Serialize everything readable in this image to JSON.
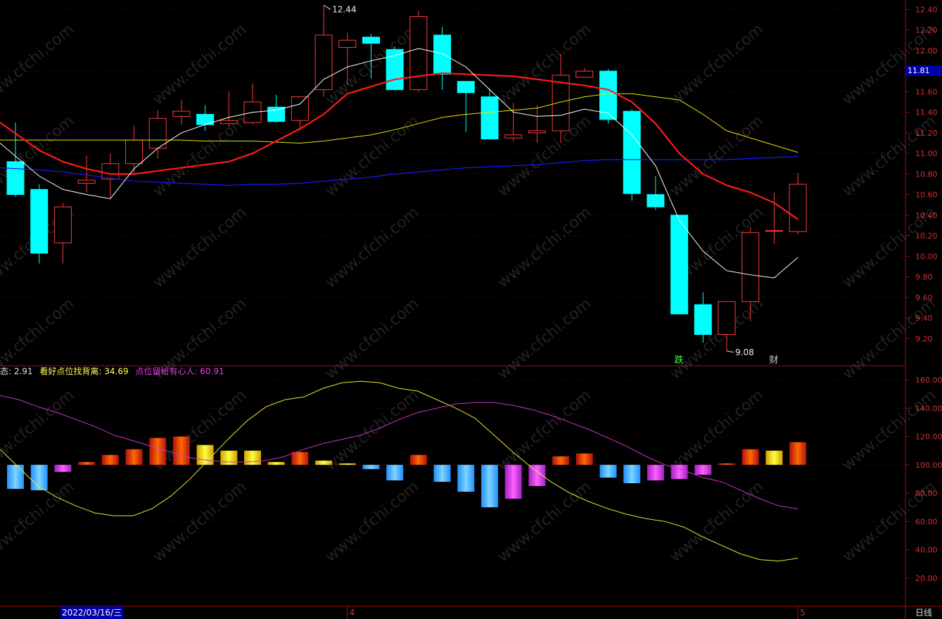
{
  "current_price_label": "11.81",
  "period_label": "日线",
  "cursor_date": "2022/03/16/三",
  "month_labels": [
    "4",
    "5"
  ],
  "indicator_header": [
    {
      "text": "态: 2.91",
      "color": "#dddddd"
    },
    {
      "text": "看好点位找背离: 34.69",
      "color": "#ffff55"
    },
    {
      "text": "点位留给有心人: 60.91",
      "color": "#e040e0"
    }
  ],
  "watermark_text": "www.cfchi.com",
  "chart_data": [
    {
      "type": "candlestick",
      "yaxis_ticks": [
        "12.40",
        "12.20",
        "12.00",
        "11.80",
        "11.60",
        "11.40",
        "11.20",
        "11.00",
        "10.80",
        "10.60",
        "10.40",
        "10.20",
        "10.00",
        "9.80",
        "9.60",
        "9.40",
        "9.20"
      ],
      "ylim": [
        9.1,
        12.45
      ],
      "colors": {
        "up": "#ff3b3b",
        "down": "#00ffff",
        "ma_fast": "#ffffff",
        "ma_mid": "#ff1a1a",
        "ma_slow": "#e6e600",
        "ma_long": "#1a1aff"
      },
      "candles": [
        {
          "o": 10.92,
          "h": 11.3,
          "l": 10.58,
          "c": 10.6
        },
        {
          "o": 10.65,
          "h": 10.7,
          "l": 9.93,
          "c": 10.03
        },
        {
          "o": 10.13,
          "h": 10.52,
          "l": 9.93,
          "c": 10.48
        },
        {
          "o": 10.71,
          "h": 10.98,
          "l": 10.62,
          "c": 10.74
        },
        {
          "o": 10.75,
          "h": 11.0,
          "l": 10.57,
          "c": 10.9
        },
        {
          "o": 10.9,
          "h": 11.27,
          "l": 10.81,
          "c": 11.13
        },
        {
          "o": 11.05,
          "h": 11.42,
          "l": 10.95,
          "c": 11.34
        },
        {
          "o": 11.36,
          "h": 11.52,
          "l": 11.28,
          "c": 11.41
        },
        {
          "o": 11.38,
          "h": 11.47,
          "l": 11.22,
          "c": 11.28
        },
        {
          "o": 11.29,
          "h": 11.6,
          "l": 11.26,
          "c": 11.32
        },
        {
          "o": 11.3,
          "h": 11.68,
          "l": 11.28,
          "c": 11.5
        },
        {
          "o": 11.45,
          "h": 11.57,
          "l": 11.3,
          "c": 11.31
        },
        {
          "o": 11.32,
          "h": 11.55,
          "l": 11.22,
          "c": 11.55
        },
        {
          "o": 11.62,
          "h": 12.44,
          "l": 11.55,
          "c": 12.15
        },
        {
          "o": 12.03,
          "h": 12.17,
          "l": 11.66,
          "c": 12.1
        },
        {
          "o": 12.13,
          "h": 12.16,
          "l": 11.73,
          "c": 12.07
        },
        {
          "o": 12.01,
          "h": 12.04,
          "l": 11.61,
          "c": 11.62
        },
        {
          "o": 11.62,
          "h": 12.39,
          "l": 11.6,
          "c": 12.33
        },
        {
          "o": 12.15,
          "h": 12.23,
          "l": 11.62,
          "c": 11.77
        },
        {
          "o": 11.7,
          "h": 11.7,
          "l": 11.21,
          "c": 11.59
        },
        {
          "o": 11.55,
          "h": 11.63,
          "l": 11.15,
          "c": 11.14
        },
        {
          "o": 11.15,
          "h": 11.49,
          "l": 11.12,
          "c": 11.18
        },
        {
          "o": 11.2,
          "h": 11.47,
          "l": 11.1,
          "c": 11.22
        },
        {
          "o": 11.22,
          "h": 11.97,
          "l": 11.1,
          "c": 11.76
        },
        {
          "o": 11.74,
          "h": 11.83,
          "l": 11.74,
          "c": 11.8
        },
        {
          "o": 11.8,
          "h": 11.82,
          "l": 11.29,
          "c": 11.33
        },
        {
          "o": 11.41,
          "h": 11.43,
          "l": 10.54,
          "c": 10.61
        },
        {
          "o": 10.6,
          "h": 10.78,
          "l": 10.45,
          "c": 10.48
        },
        {
          "o": 10.4,
          "h": 10.4,
          "l": 9.44,
          "c": 9.44
        },
        {
          "o": 9.53,
          "h": 9.65,
          "l": 9.16,
          "c": 9.24
        },
        {
          "o": 9.24,
          "h": 9.56,
          "l": 9.08,
          "c": 9.56
        },
        {
          "o": 9.56,
          "h": 10.28,
          "l": 9.37,
          "c": 10.23
        },
        {
          "o": 10.25,
          "h": 10.62,
          "l": 10.12,
          "c": 10.25
        },
        {
          "o": 10.24,
          "h": 10.81,
          "l": 10.21,
          "c": 10.7
        }
      ],
      "ma_fast": [
        11.1,
        10.78,
        10.65,
        10.6,
        10.56,
        10.85,
        11.05,
        11.2,
        11.28,
        11.35,
        11.4,
        11.42,
        11.48,
        11.72,
        11.84,
        11.9,
        11.95,
        12.02,
        11.97,
        11.84,
        11.62,
        11.4,
        11.36,
        11.37,
        11.43,
        11.39,
        11.18,
        10.88,
        10.35,
        10.05,
        9.86,
        9.82,
        9.79,
        9.99
      ],
      "ma_mid": [
        11.3,
        11.03,
        10.92,
        10.85,
        10.8,
        10.8,
        10.83,
        10.86,
        10.89,
        10.92,
        11.0,
        11.12,
        11.24,
        11.38,
        11.58,
        11.65,
        11.72,
        11.75,
        11.78,
        11.77,
        11.76,
        11.75,
        11.72,
        11.69,
        11.66,
        11.62,
        11.5,
        11.29,
        11.0,
        10.8,
        10.69,
        10.62,
        10.52,
        10.36
      ],
      "ma_slow": [
        11.13,
        11.13,
        11.13,
        11.13,
        11.13,
        11.13,
        11.13,
        11.13,
        11.12,
        11.12,
        11.12,
        11.11,
        11.1,
        11.12,
        11.15,
        11.18,
        11.23,
        11.29,
        11.35,
        11.38,
        11.4,
        11.42,
        11.44,
        11.5,
        11.55,
        11.58,
        11.58,
        11.55,
        11.52,
        11.38,
        11.22,
        11.15,
        11.08,
        11.01
      ],
      "ma_long": [
        10.86,
        10.84,
        10.82,
        10.79,
        10.76,
        10.73,
        10.72,
        10.71,
        10.7,
        10.69,
        10.7,
        10.7,
        10.71,
        10.73,
        10.75,
        10.77,
        10.8,
        10.82,
        10.84,
        10.86,
        10.87,
        10.88,
        10.89,
        10.91,
        10.93,
        10.94,
        10.94,
        10.94,
        10.94,
        10.94,
        10.94,
        10.95,
        10.96,
        10.97
      ],
      "annotations": [
        {
          "text": "12.44",
          "candle": 13,
          "at": "high"
        },
        {
          "text": "9.08",
          "candle": 30,
          "at": "low"
        }
      ],
      "markers": [
        {
          "text": "跌",
          "candle": 28,
          "color": "#44ff44"
        },
        {
          "text": "财",
          "candle": 32,
          "color": "#cccccc"
        }
      ]
    },
    {
      "type": "bar",
      "yaxis_ticks": [
        "160.00",
        "140.00",
        "120.00",
        "100.00",
        "80.00",
        "60.00",
        "40.00",
        "20.00"
      ],
      "ylim": [
        5,
        165
      ],
      "baseline": 100,
      "bars": [
        {
          "v": 83,
          "color": "blue"
        },
        {
          "v": 82,
          "color": "blue"
        },
        {
          "v": 95,
          "color": "magenta"
        },
        {
          "v": 102,
          "color": "red"
        },
        {
          "v": 107,
          "color": "red"
        },
        {
          "v": 111,
          "color": "red"
        },
        {
          "v": 119,
          "color": "red"
        },
        {
          "v": 120,
          "color": "red"
        },
        {
          "v": 114,
          "color": "yellow"
        },
        {
          "v": 110,
          "color": "yellow"
        },
        {
          "v": 110,
          "color": "yellow"
        },
        {
          "v": 102,
          "color": "yellow"
        },
        {
          "v": 109,
          "color": "red"
        },
        {
          "v": 103,
          "color": "yellow"
        },
        {
          "v": 101,
          "color": "yellow"
        },
        {
          "v": 97,
          "color": "blue"
        },
        {
          "v": 89,
          "color": "blue"
        },
        {
          "v": 107,
          "color": "red"
        },
        {
          "v": 88,
          "color": "blue"
        },
        {
          "v": 81,
          "color": "blue"
        },
        {
          "v": 70,
          "color": "blue"
        },
        {
          "v": 76,
          "color": "magenta"
        },
        {
          "v": 85,
          "color": "magenta"
        },
        {
          "v": 106,
          "color": "red"
        },
        {
          "v": 108,
          "color": "red"
        },
        {
          "v": 91,
          "color": "blue"
        },
        {
          "v": 87,
          "color": "blue"
        },
        {
          "v": 89,
          "color": "magenta"
        },
        {
          "v": 90,
          "color": "magenta"
        },
        {
          "v": 93,
          "color": "magenta"
        },
        {
          "v": 101,
          "color": "red"
        },
        {
          "v": 111,
          "color": "red"
        },
        {
          "v": 110,
          "color": "yellow"
        },
        {
          "v": 116,
          "color": "red"
        }
      ],
      "line_yellow": [
        111,
        98,
        85,
        77,
        71,
        66,
        64,
        64,
        69,
        78,
        90,
        104,
        118,
        131,
        141,
        146,
        148,
        154,
        158,
        159,
        158,
        154,
        152,
        146,
        140,
        133,
        121,
        109,
        98,
        88,
        80,
        74,
        69,
        65,
        62,
        60,
        56,
        49,
        43,
        37,
        33,
        32,
        34
      ],
      "line_magenta": [
        149,
        146,
        141,
        137,
        132,
        127,
        121,
        117,
        113,
        109,
        105,
        103,
        102,
        102,
        103,
        106,
        111,
        115,
        118,
        121,
        126,
        132,
        137,
        140,
        143,
        144,
        144,
        142,
        139,
        135,
        130,
        125,
        119,
        113,
        106,
        100,
        96,
        91,
        88,
        82,
        76,
        71,
        69
      ],
      "bar_colors": {
        "blue": [
          "#1e90ff",
          "#7fd4ff"
        ],
        "magenta": [
          "#a020c0",
          "#ff60ff"
        ],
        "red": [
          "#b01010",
          "#ff6a00"
        ],
        "yellow": [
          "#d0a000",
          "#ffff40"
        ]
      }
    }
  ]
}
